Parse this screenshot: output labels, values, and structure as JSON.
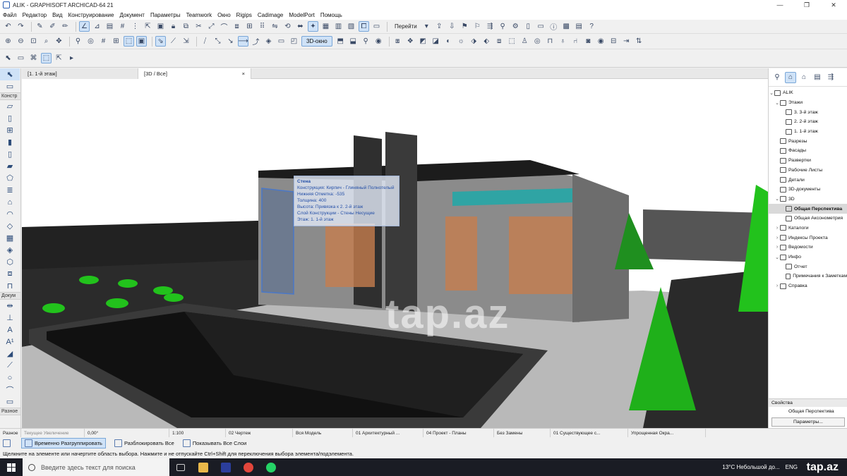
{
  "window": {
    "title": "ALIK - GRAPHISOFT ARCHICAD-64 21",
    "controls": [
      "—",
      "❐",
      "✕"
    ]
  },
  "menu": [
    "Файл",
    "Редактор",
    "Вид",
    "Конструирование",
    "Документ",
    "Параметры",
    "Teamwork",
    "Окно",
    "Rigips",
    "Cadimage",
    "ModelPort",
    "Помощь"
  ],
  "toolbar": {
    "goto_label": "Перейти",
    "view3d_label": "3D-окно"
  },
  "toolbox": {
    "select_label": "Указатель",
    "construct_label": "Констр",
    "document_label": "Докум",
    "misc_label": "Разное"
  },
  "tabs": [
    {
      "label": "[1. 1-й этаж]"
    },
    {
      "label": "[3D / Все]",
      "close": "×"
    }
  ],
  "viewport": {
    "watermark": "tap.az"
  },
  "tooltip": {
    "title": "Стена",
    "lines": [
      "Конструкция: Кирпич - Глиняный Полнотелый",
      "Нижняя Отметка: -535",
      "Толщина: 400",
      "Высота: Привязка к 2. 2-й этаж",
      "Слой Конструкции - Стены Несущие",
      "Этаж: 1. 1-й этаж"
    ]
  },
  "navigator": {
    "root": "ALIK",
    "stories_label": "Этажи",
    "stories": [
      "3. 3-й этаж",
      "2. 2-й этаж",
      "1. 1-й этаж"
    ],
    "sections": [
      "Разрезы",
      "Фасады",
      "Развертки",
      "Рабочие Листы",
      "Детали",
      "3D-документы"
    ],
    "three_d": "3D",
    "three_d_items": [
      "Общая Перспектива",
      "Общая Аксонометрия"
    ],
    "more": [
      "Каталоги",
      "Индексы Проекта",
      "Ведомости"
    ],
    "info_label": "Инфо",
    "info_items": [
      "Отчет",
      "Примечания к Заметкам"
    ],
    "help": "Справка",
    "props_label": "Свойства",
    "props_value": "Общая Перспектива",
    "params_button": "Параметры..."
  },
  "status": {
    "placeholder": "Текущее Увеличение",
    "angle": "0,00°",
    "scale": "1:100",
    "drawing": "02 Чертеж",
    "model": "Вся Модель",
    "arch": "01 Архитектурный ...",
    "project": "04 Проект - Планы",
    "no_changes": "Без Замены",
    "existing": "01 Существующее с...",
    "simplified": "Упрощенная Окра..."
  },
  "actions": {
    "ungroup": "Временно Разгруппировать",
    "unlock": "Разблокировать Все",
    "show_layers": "Показывать Все Слои"
  },
  "hint": "Щелкните на элементе или начертите область выбора. Нажмите и не отпускайте Ctrl+Shift для переключения выбора элемента/подэлемента.",
  "taskbar": {
    "search_placeholder": "Введите здесь текст для поиска",
    "weather": "13°C  Небольшой до...",
    "lang": "ENG",
    "brand": "tap.az"
  }
}
